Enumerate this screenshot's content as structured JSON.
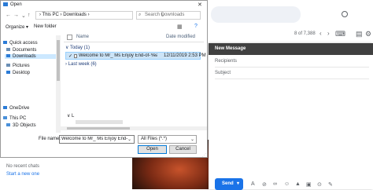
{
  "gmail": {
    "page_count": "8 of 7,388",
    "recent_chats": "No recent chats",
    "start_chat": "Start a new one"
  },
  "compose": {
    "title": "New Message",
    "recipients_placeholder": "Recipients",
    "subject_placeholder": "Subject",
    "send_label": "Send",
    "send_more": "▾",
    "toolbar_icons": [
      "format-icon",
      "attach-icon",
      "link-icon",
      "emoji-icon",
      "drive-icon",
      "photo-icon",
      "lock-icon",
      "signature-icon"
    ]
  },
  "dialog": {
    "title": "Open",
    "close": "✕",
    "breadcrumb": "›  This PC  ›  Downloads  ›",
    "search_placeholder": "Search Downloads",
    "organize": "Organize ▾",
    "new_folder": "New folder",
    "nav_items": [
      {
        "label": "Quick access",
        "color": "#2b7bd6"
      },
      {
        "label": "Documents",
        "color": "#6b8fb5"
      },
      {
        "label": "Downloads",
        "color": "#2b7bd6",
        "selected": true
      },
      {
        "label": "Pictures",
        "color": "#6b8fb5"
      },
      {
        "label": "Desktop",
        "color": "#2b7bd6"
      },
      {
        "label": "OneDrive",
        "color": "#2b7bd6"
      },
      {
        "label": "This PC",
        "color": "#4a90d9"
      },
      {
        "label": "3D Objects",
        "color": "#4a90d9"
      }
    ],
    "col_name": "Name",
    "col_date": "Date modified",
    "group_today": "∨  Today (1)",
    "file": {
      "name": "Welcome to Mr_ Ms Enjoy End-of-Year-Sale-...",
      "date": "12/11/2019 2:53 PM"
    },
    "group_last_week": "›  Last week (6)",
    "group_blurred": "∨  L",
    "file_name_label": "File name:",
    "file_name_value": "Welcome to Mr_ Ms Enjoy End-of-Year-Sale",
    "filter": "All Files (*.*)",
    "open": "Open",
    "cancel": "Cancel"
  }
}
